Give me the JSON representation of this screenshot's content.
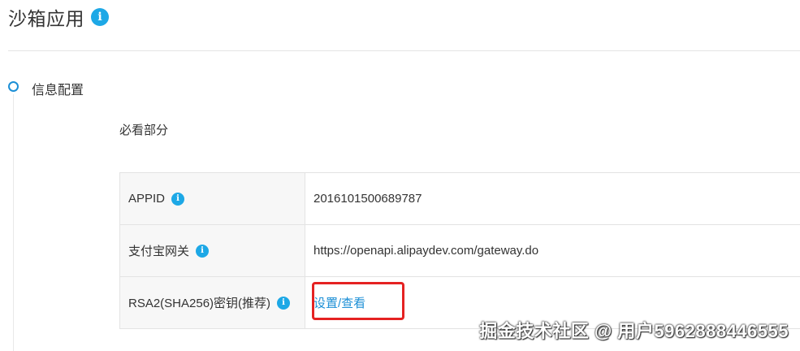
{
  "header": {
    "title": "沙箱应用",
    "info_icon": "info-icon"
  },
  "section": {
    "title": "信息配置",
    "subsection_title": "必看部分"
  },
  "config": {
    "rows": [
      {
        "label": "APPID",
        "icon": "info-icon",
        "value": "2016101500689787"
      },
      {
        "label": "支付宝网关",
        "icon": "info-icon",
        "value": "https://openapi.alipaydev.com/gateway.do"
      },
      {
        "label": "RSA2(SHA256)密钥(推荐)",
        "icon": "info-icon",
        "value": "设置/查看"
      }
    ]
  },
  "watermark": {
    "text": "掘金技术社区 @ 用户5962888446555"
  },
  "colors": {
    "accent": "#1da8e6",
    "link": "#1c8fd6",
    "highlight": "#e52222"
  }
}
